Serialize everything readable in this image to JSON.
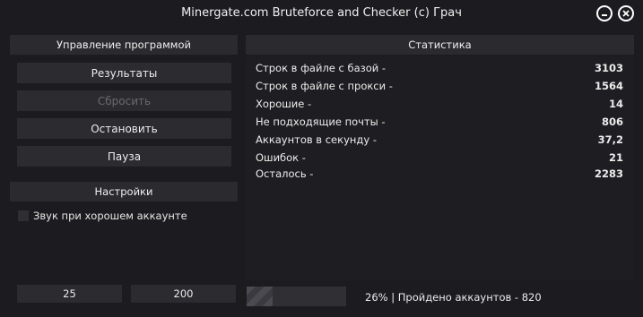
{
  "window": {
    "title": "Minergate.com Bruteforce and Checker (c) Грач"
  },
  "control": {
    "header": "Управление программой",
    "buttons": {
      "results": "Результаты",
      "reset": "Сбросить",
      "stop": "Остановить",
      "pause": "Пауза"
    },
    "settings_header": "Настройки",
    "sound_checkbox_label": "Звук при хорошем аккаунте",
    "sound_checked": false,
    "value_left": "25",
    "value_right": "200"
  },
  "stats": {
    "header": "Статистика",
    "rows": [
      {
        "label": "Строк в файле с базой -",
        "value": "3103"
      },
      {
        "label": "Строк в файле с прокси -",
        "value": "1564"
      },
      {
        "label": "Хорошие -",
        "value": "14"
      },
      {
        "label": "Не подходящие почты -",
        "value": "806"
      },
      {
        "label": "Аккаунтов в секунду -",
        "value": "37,2"
      },
      {
        "label": "Ошибок -",
        "value": "21"
      },
      {
        "label": "Осталось -",
        "value": "2283"
      }
    ]
  },
  "progress": {
    "percent": 26,
    "text": "26% | Пройдено аккаунтов - 820"
  },
  "icons": {
    "minimize": "minimize-icon",
    "close": "close-icon"
  }
}
